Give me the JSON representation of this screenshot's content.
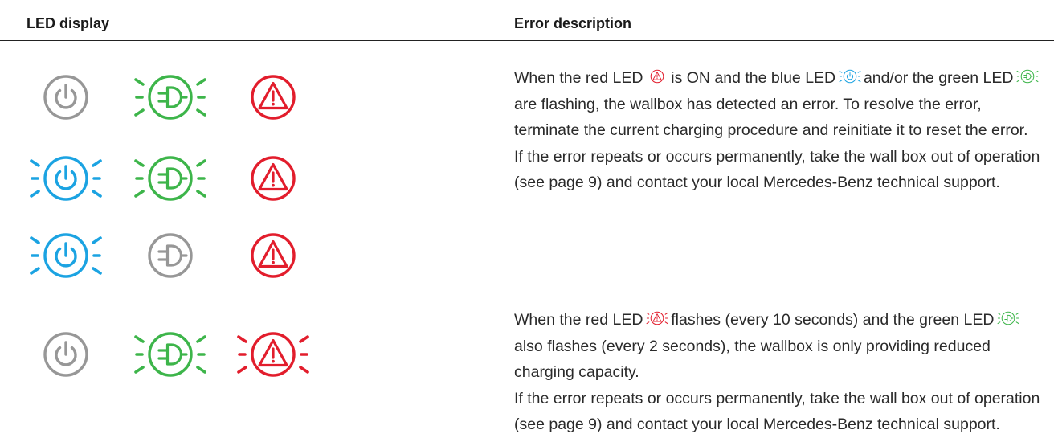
{
  "headers": {
    "led_display": "LED display",
    "error_description": "Error description"
  },
  "colors": {
    "gray": "#979797",
    "green": "#3db54a",
    "blue": "#1ba3e2",
    "red": "#e21d2c",
    "rule": "#222222"
  },
  "sections": [
    {
      "icon_rows": [
        [
          {
            "icon": "power-icon",
            "color": "gray",
            "state": "steady"
          },
          {
            "icon": "plug-icon",
            "color": "green",
            "state": "flashing"
          },
          {
            "icon": "warning-icon",
            "color": "red",
            "state": "steady"
          }
        ],
        [
          {
            "icon": "power-icon",
            "color": "blue",
            "state": "flashing"
          },
          {
            "icon": "plug-icon",
            "color": "green",
            "state": "flashing"
          },
          {
            "icon": "warning-icon",
            "color": "red",
            "state": "steady"
          }
        ],
        [
          {
            "icon": "power-icon",
            "color": "blue",
            "state": "flashing"
          },
          {
            "icon": "plug-icon",
            "color": "gray",
            "state": "steady"
          },
          {
            "icon": "warning-icon",
            "color": "red",
            "state": "steady"
          }
        ]
      ],
      "paragraphs": [
        {
          "t1": "When the red LED ",
          "t2": " is ON and the blue LED ",
          "t3": " and/or the green LED ",
          "t4": " are flashing, the wallbox has detected an error. To resolve the error, terminate the cur­rent charging procedure and reinitiate it to reset the error."
        },
        {
          "text": "If the error repeats or occurs permanently, take the wall box out of operation (see page 9) and contact your local Mercedes-Benz technical support."
        }
      ]
    },
    {
      "icon_rows": [
        [
          {
            "icon": "power-icon",
            "color": "gray",
            "state": "steady"
          },
          {
            "icon": "plug-icon",
            "color": "green",
            "state": "flashing"
          },
          {
            "icon": "warning-icon",
            "color": "red",
            "state": "flashing"
          }
        ]
      ],
      "paragraphs": [
        {
          "t1": "When the red LED ",
          "t2": " flashes (every 10 seconds) and the green LED ",
          "t3": " also flashes (every 2 seconds), the wallbox is only providing reduced charging capacity."
        },
        {
          "text": "If the error repeats or occurs permanently, take the wall box out of operation (see page 9) and contact your local Mercedes-Benz technical support."
        }
      ]
    }
  ]
}
